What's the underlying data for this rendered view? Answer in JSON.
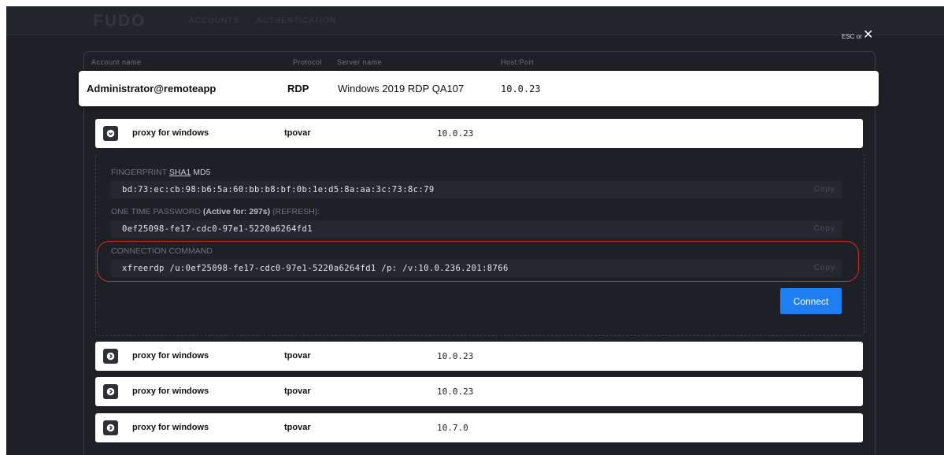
{
  "header": {
    "logo": "FUDO",
    "tabs": [
      "ACCOUNTS",
      "AUTHENTICATION"
    ],
    "esc_label": "ESC or"
  },
  "columns": {
    "account": "Account name",
    "protocol": "Protocol",
    "server": "Server name",
    "host": "Host:Port"
  },
  "account": {
    "name": "Administrator@remoteapp",
    "protocol": "RDP",
    "server": "Windows 2019 RDP QA107",
    "host": "10.0.23"
  },
  "proxies": [
    {
      "name": "proxy for windows",
      "user": "tpovar",
      "host": "10.0.23"
    },
    {
      "name": "proxy for windows",
      "user": "tpovar",
      "host": "10.0.23"
    },
    {
      "name": "proxy for windows",
      "user": "tpovar",
      "host": "10.0.23"
    },
    {
      "name": "proxy for windows",
      "user": "tpovar",
      "host": "10.7.0"
    }
  ],
  "details": {
    "fingerprint_label": "FINGERPRINT",
    "sha1": "SHA1",
    "md5": "MD5",
    "fingerprint_value": "bd:73:ec:cb:98:b6:5a:60:bb:b8:bf:0b:1e:d5:8a:aa:3c:73:8c:79",
    "otp_label": "ONE TIME PASSWORD",
    "otp_active": "(Active for: 297s)",
    "otp_refresh": "(REFRESH):",
    "otp_value": "0ef25098-fe17-cdc0-97e1-5220a6264fd1",
    "command_label": "CONNECTION COMMAND",
    "command_value": "xfreerdp /u:0ef25098-fe17-cdc0-97e1-5220a6264fd1 /p: /v:10.0.236.201:8766",
    "copy_label": "Copy",
    "connect_label": "Connect"
  },
  "colors": {
    "background": "#1e2026",
    "accent": "#1f7ef2",
    "highlight": "#c8321c"
  }
}
